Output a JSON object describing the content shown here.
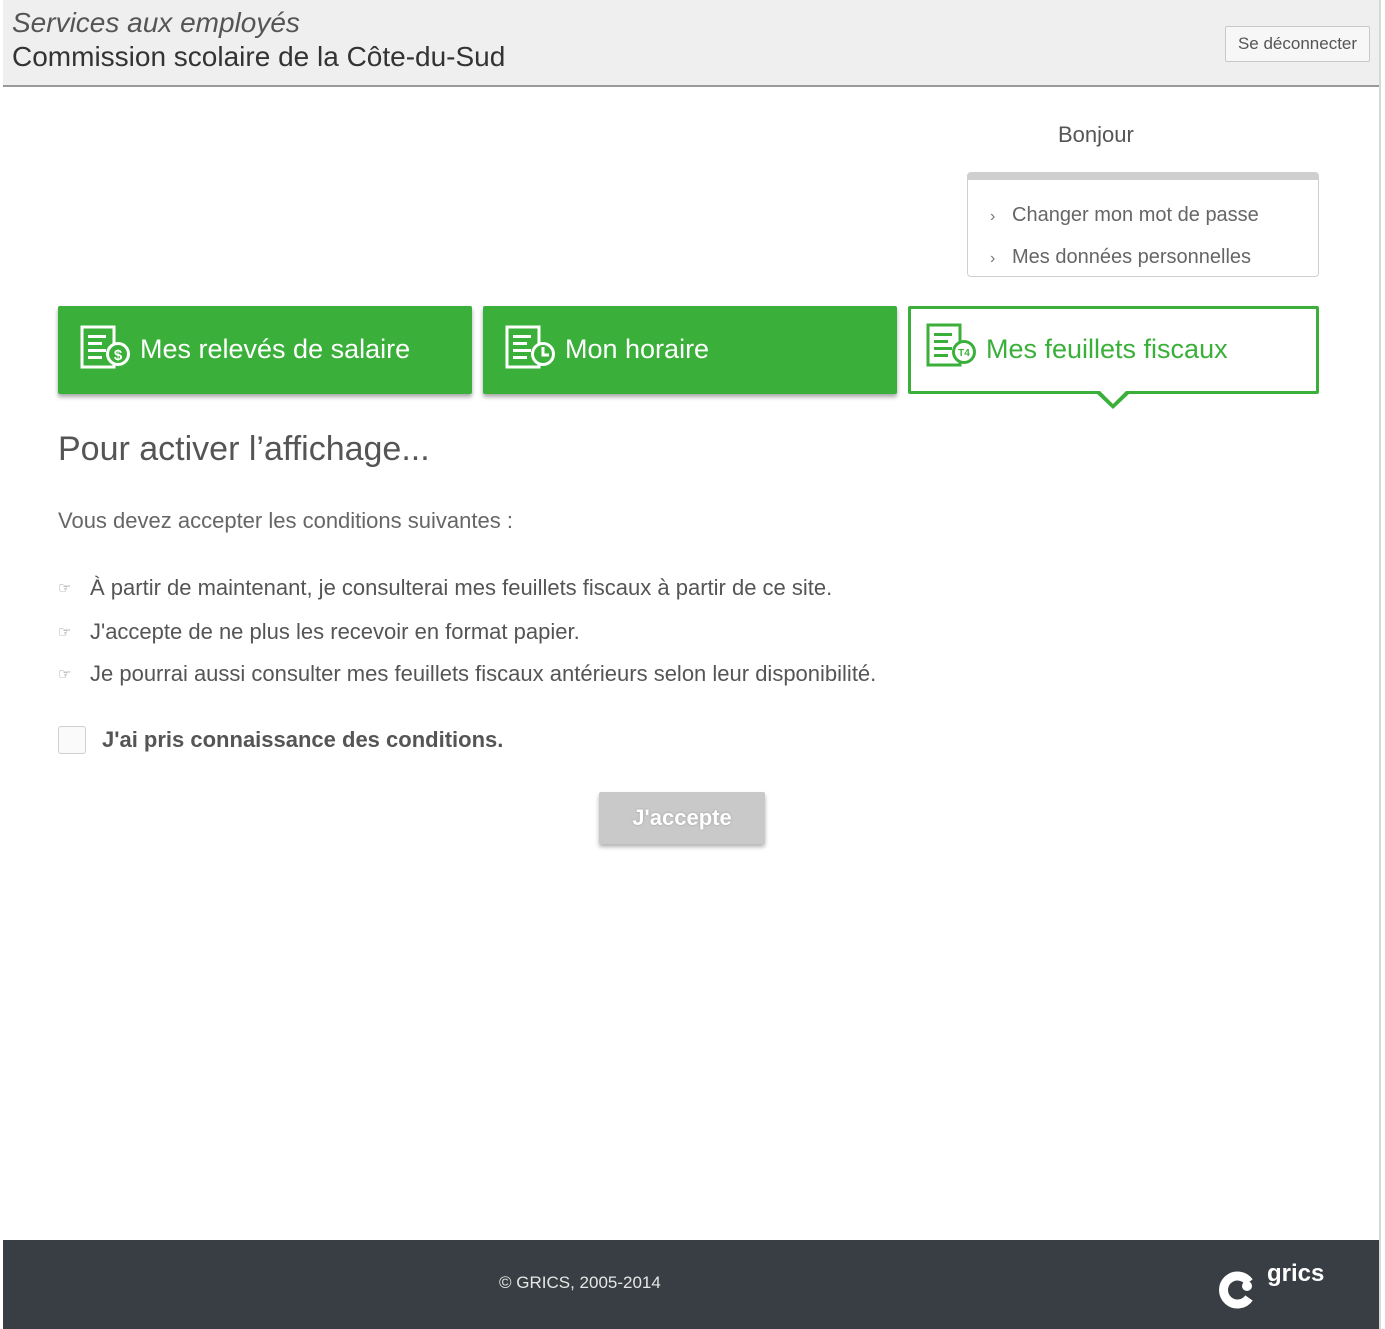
{
  "header": {
    "service_title": "Services aux employés",
    "organization": "Commission scolaire de la Côte-du-Sud",
    "logout_label": "Se déconnecter"
  },
  "user": {
    "greeting": "Bonjour",
    "menu": [
      {
        "label": "Changer mon mot de passe",
        "icon": "chevron-right-icon"
      },
      {
        "label": "Mes données personnelles",
        "icon": "chevron-right-icon"
      }
    ]
  },
  "tabs": [
    {
      "label": "Mes relevés de salaire",
      "icon": "pay-stub-dollar-icon",
      "icon_badge": "$",
      "active": false
    },
    {
      "label": "Mon horaire",
      "icon": "schedule-clock-icon",
      "icon_badge": "",
      "active": false
    },
    {
      "label": "Mes feuillets fiscaux",
      "icon": "tax-slip-t4-icon",
      "icon_badge": "T4",
      "active": true
    }
  ],
  "content": {
    "title": "Pour activer l’affichage...",
    "intro": "Vous devez accepter les conditions suivantes :",
    "conditions": [
      "À partir de maintenant, je consulterai mes feuillets fiscaux à partir de ce site.",
      "J'accepte de ne plus les recevoir en format papier.",
      "Je pourrai aussi consulter mes feuillets fiscaux antérieurs selon leur disponibilité."
    ],
    "bullet_icon": "pointing-hand-icon",
    "checkbox_label": "J'ai pris connaissance des conditions.",
    "checkbox_checked": false,
    "accept_label": "J'accepte",
    "accept_enabled": false
  },
  "footer": {
    "copyright": "© GRICS, 2005-2014",
    "logo_text": "grics"
  },
  "colors": {
    "accent_green": "#3ab03a",
    "footer_bg": "#383e43",
    "header_bg": "#efefef",
    "disabled_button": "#c9c9c9"
  }
}
